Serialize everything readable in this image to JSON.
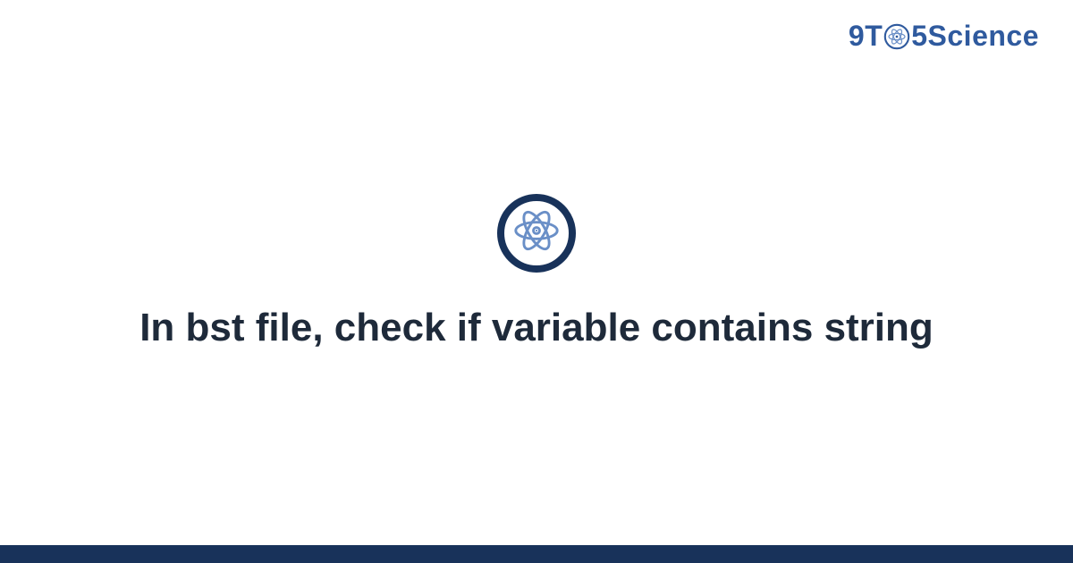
{
  "brand": {
    "prefix": "9T",
    "suffix": "5Science"
  },
  "title": "In bst file, check if variable contains string",
  "colors": {
    "dark_navy": "#18325a",
    "brand_blue": "#2f5a9e",
    "atom_blue": "#6a8fc7",
    "text": "#1e2a3a"
  }
}
